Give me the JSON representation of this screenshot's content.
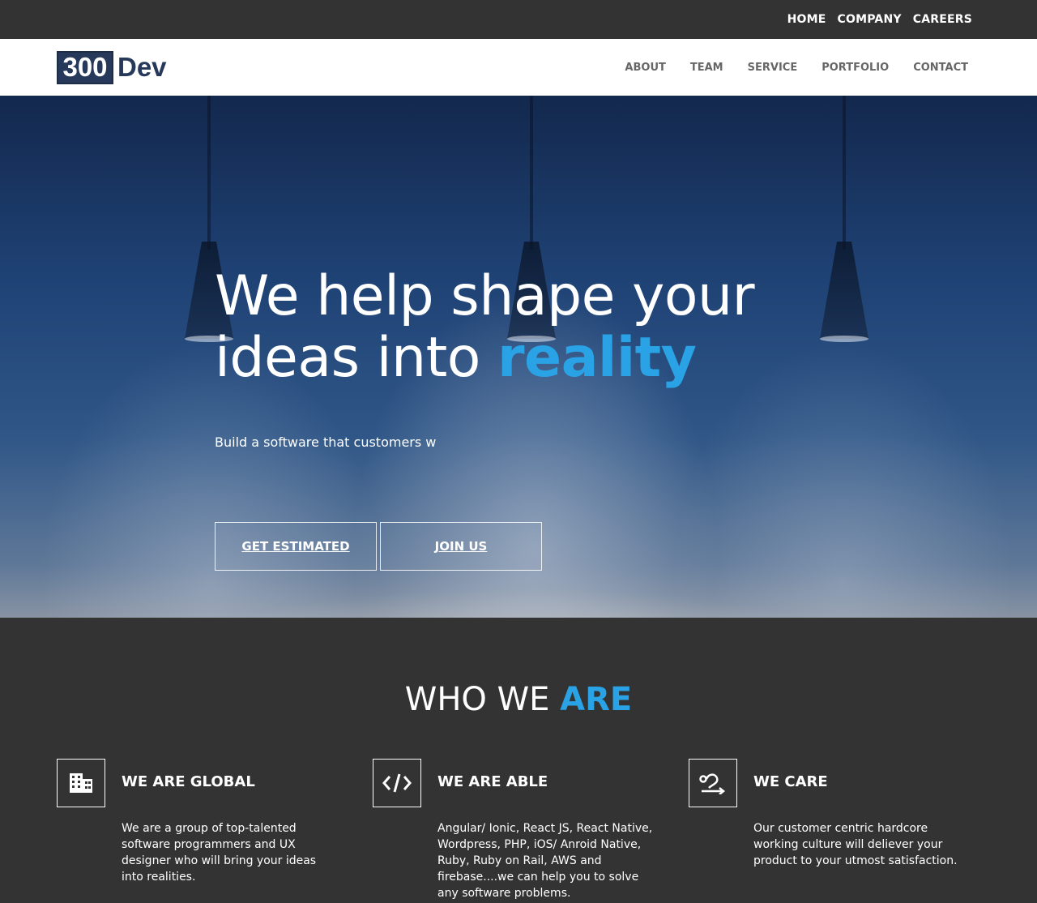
{
  "topnav": {
    "items": [
      "HOME",
      "COMPANY",
      "CAREERS"
    ]
  },
  "header": {
    "logo_number": "300",
    "logo_text": "Dev",
    "nav": [
      "ABOUT",
      "TEAM",
      "SERVICE",
      "PORTFOLIO",
      "CONTACT"
    ]
  },
  "hero": {
    "title_line1": "We help shape your",
    "title_line2_prefix": "ideas into ",
    "title_highlight": "reality",
    "subtitle": "Build a software that customers w",
    "btn_estimate": "GET ESTIMATED",
    "btn_join": "JOIN US"
  },
  "who": {
    "title_prefix": "WHO WE ",
    "title_highlight": "ARE",
    "features": [
      {
        "icon": "building-icon",
        "heading": "WE ARE GLOBAL",
        "text": "We are a group of top-talented software programmers and UX designer who will bring your ideas into realities."
      },
      {
        "icon": "code-icon",
        "heading": "WE ARE ABLE",
        "text": "Angular/ Ionic, React JS, React Native, Wordpress, PHP, iOS/ Anroid Native, Ruby, Ruby on Rail, AWS and firebase....we can help you to solve any software problems."
      },
      {
        "icon": "process-icon",
        "heading": "WE CARE",
        "text": "Our customer centric hardcore working culture will deliever your product to your utmost satisfaction."
      }
    ]
  },
  "colors": {
    "accent": "#2aa3e6",
    "dark": "#333333",
    "logo": "#27395a"
  }
}
